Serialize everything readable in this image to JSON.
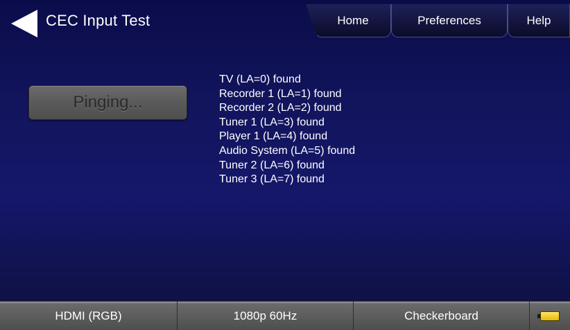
{
  "header": {
    "title": "CEC Input Test",
    "back_icon": "back-arrow-icon",
    "tabs": [
      {
        "label": "Home"
      },
      {
        "label": "Preferences"
      },
      {
        "label": "Help"
      }
    ]
  },
  "main": {
    "ping_button_label": "Pinging...",
    "results": [
      "TV (LA=0) found",
      "Recorder 1 (LA=1) found",
      "Recorder 2 (LA=2) found",
      "Tuner 1 (LA=3) found",
      "Player 1 (LA=4) found",
      "Audio System (LA=5) found",
      "Tuner 2 (LA=6) found",
      "Tuner 3 (LA=7) found"
    ]
  },
  "status_bar": {
    "interface": "HDMI (RGB)",
    "format": "1080p 60Hz",
    "image": "Checkerboard",
    "battery_icon": "battery-icon",
    "battery_color": "#f5c800"
  },
  "colors": {
    "background": "#12145c",
    "text": "#ffffff"
  }
}
